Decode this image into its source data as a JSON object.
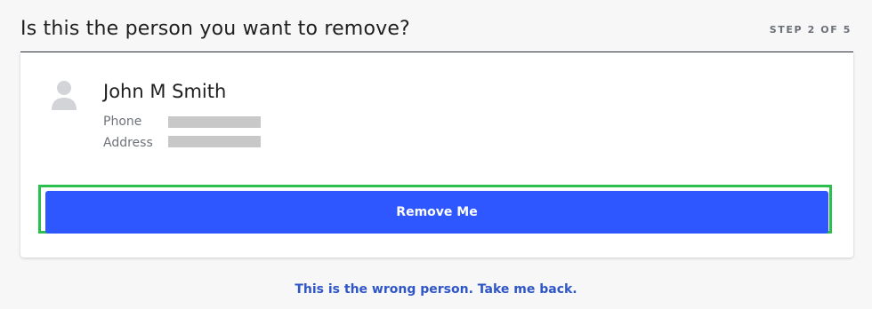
{
  "header": {
    "title": "Is this the person you want to remove?",
    "step": "STEP 2 OF 5"
  },
  "person": {
    "name": "John M Smith",
    "phone_label": "Phone",
    "address_label": "Address",
    "avatar_icon": "user-silhouette-icon"
  },
  "actions": {
    "remove_label": "Remove Me",
    "back_label": "This is the wrong person. Take me back."
  },
  "colors": {
    "primary_button": "#2e57ff",
    "highlight_border": "#2bbf4e",
    "link": "#2f56c7",
    "background": "#f7f7f8",
    "redaction": "#c8c8c8"
  }
}
